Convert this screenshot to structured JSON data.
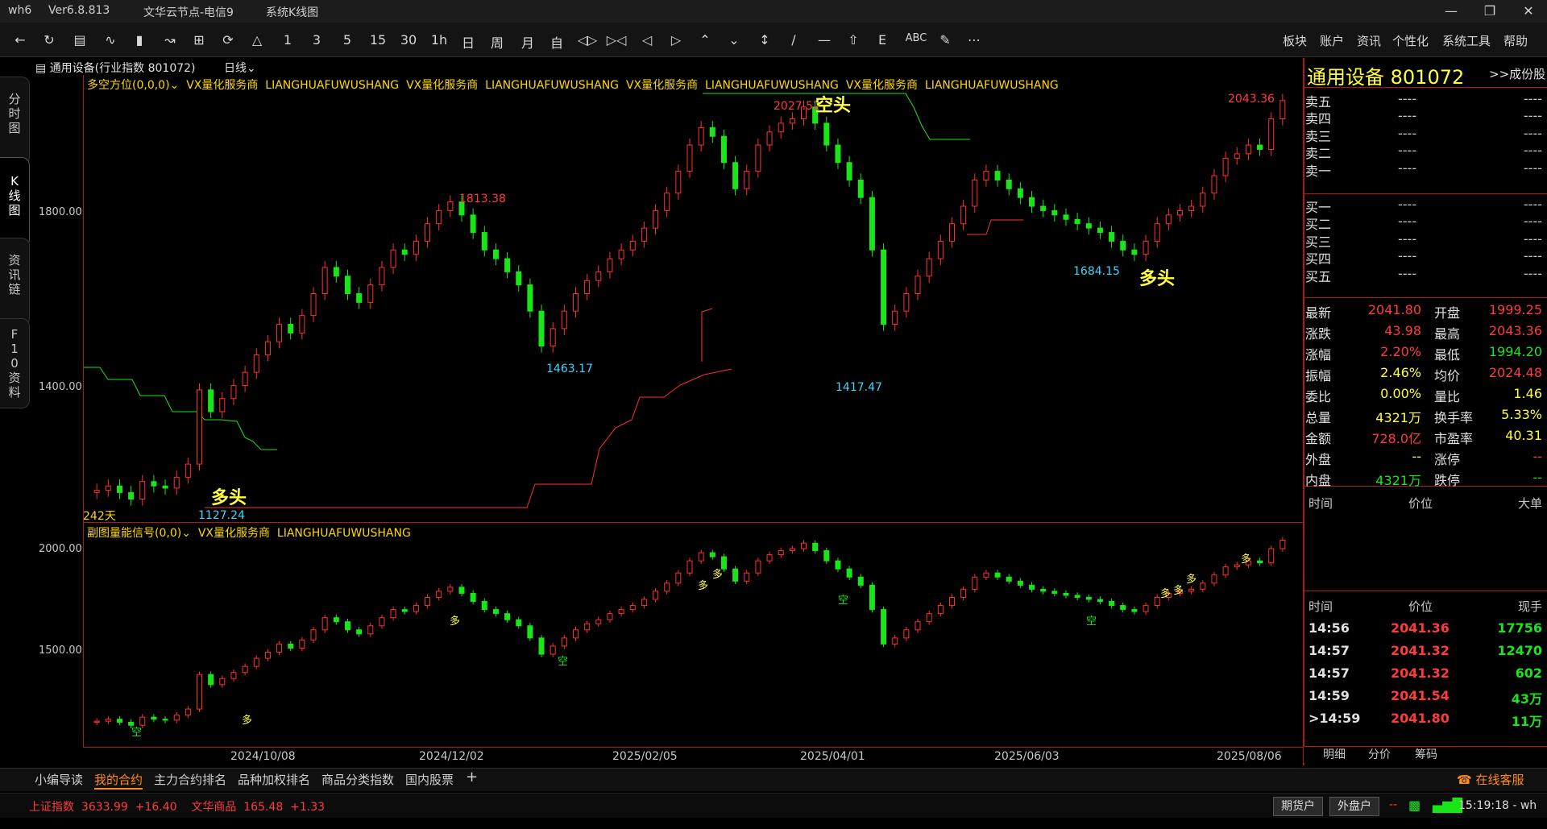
{
  "titlebar": {
    "app": "wh6",
    "version": "Ver6.8.813",
    "server": "文华云节点-电信9",
    "window": "系统K线图"
  },
  "toolbar": {
    "icons": [
      "back-icon",
      "refresh-icon",
      "table-icon",
      "line-chart-icon",
      "bar-chart-icon",
      "drawing-icon",
      "plus-box-icon",
      "refresh2-icon",
      "bell-icon"
    ],
    "periods": [
      "1",
      "3",
      "5",
      "15",
      "30",
      "1h",
      "日",
      "周",
      "月",
      "自"
    ],
    "menus": [
      "板块",
      "账户",
      "资讯",
      "个性化",
      "系统工具",
      "帮助"
    ],
    "abc": "ABC"
  },
  "left_tabs": [
    {
      "label": "分时图"
    },
    {
      "label": "K线图"
    },
    {
      "label": "资讯链"
    },
    {
      "label": "F10资料"
    }
  ],
  "chart_header": {
    "instrument": "通用设备(行业指数 801072)",
    "period": "日线"
  },
  "main_indicator": {
    "name": "多空方位(0,0,0)",
    "labels": [
      "VX量化服务商",
      "LIANGHUAFUWUSHANG",
      "VX量化服务商",
      "LIANGHUAFUWUSHANG",
      "VX量化服务商",
      "LIANGHUAFUWUSHANG",
      "VX量化服务商",
      "LIANGHUAFUWUSHANG"
    ]
  },
  "sub_indicator": {
    "name": "副图量能信号(0,0)",
    "labels": [
      "VX量化服务商",
      "LIANGHUAFUWUSHANG"
    ]
  },
  "main_axis": [
    "1800.00",
    "1400.00"
  ],
  "sub_axis": [
    "2000.00",
    "1500.00"
  ],
  "dates": [
    "2024/10/08",
    "2024/12/02",
    "2025/02/05",
    "2025/04/01",
    "2025/06/03",
    "2025/08/06"
  ],
  "days_label": "242天",
  "annotations": {
    "high1": "1813.38",
    "low1": "1463.17",
    "high2": "2027.52",
    "low2": "1417.47",
    "low3": "1684.15",
    "high3": "2043.36",
    "low0": "1127.24",
    "duotou": "多头",
    "kongtou": "空头"
  },
  "sub_signals": {
    "duo": "多",
    "kong": "空"
  },
  "quote": {
    "name": "通用设备",
    "code": "801072",
    "link": ">>成份股",
    "asks": [
      {
        "label": "卖五",
        "price": "----",
        "vol": "----"
      },
      {
        "label": "卖四",
        "price": "----",
        "vol": "----"
      },
      {
        "label": "卖三",
        "price": "----",
        "vol": "----"
      },
      {
        "label": "卖二",
        "price": "----",
        "vol": "----"
      },
      {
        "label": "卖一",
        "price": "----",
        "vol": "----"
      }
    ],
    "bids": [
      {
        "label": "买一",
        "price": "----",
        "vol": "----"
      },
      {
        "label": "买二",
        "price": "----",
        "vol": "----"
      },
      {
        "label": "买三",
        "price": "----",
        "vol": "----"
      },
      {
        "label": "买四",
        "price": "----",
        "vol": "----"
      },
      {
        "label": "买五",
        "price": "----",
        "vol": "----"
      }
    ],
    "stats": [
      {
        "l": "最新",
        "lv": "2041.80",
        "r": "开盘",
        "rv": "1999.25"
      },
      {
        "l": "涨跌",
        "lv": "43.98",
        "r": "最高",
        "rv": "2043.36"
      },
      {
        "l": "涨幅",
        "lv": "2.20%",
        "r": "最低",
        "rv": "1994.20"
      },
      {
        "l": "振幅",
        "lv": "2.46%",
        "r": "均价",
        "rv": "2024.48"
      },
      {
        "l": "委比",
        "lv": "0.00%",
        "r": "量比",
        "rv": "1.46"
      },
      {
        "l": "总量",
        "lv": "4321万",
        "r": "换手率",
        "rv": "5.33%"
      },
      {
        "l": "金额",
        "lv": "728.0亿",
        "r": "市盈率",
        "rv": "40.31"
      },
      {
        "l": "外盘",
        "lv": "--",
        "r": "涨停",
        "rv": "--"
      },
      {
        "l": "内盘",
        "lv": "4321万",
        "r": "跌停",
        "rv": "--"
      }
    ],
    "block_header": [
      "时间",
      "价位",
      "大单"
    ],
    "ticks_header": [
      "时间",
      "价位",
      "现手"
    ],
    "ticks": [
      {
        "t": "14:56",
        "p": "2041.36",
        "v": "17756"
      },
      {
        "t": "14:57",
        "p": "2041.32",
        "v": "12470"
      },
      {
        "t": "14:57",
        "p": "2041.32",
        "v": "602"
      },
      {
        "t": "14:59",
        "p": "2041.54",
        "v": "43万"
      },
      {
        "t": ">14:59",
        "p": "2041.80",
        "v": "11万"
      }
    ],
    "bottom_tabs": [
      "明细",
      "分价",
      "筹码"
    ]
  },
  "bottom_tabs": [
    "小编导读",
    "我的合约",
    "主力合约排名",
    "品种加权排名",
    "商品分类指数",
    "国内股票"
  ],
  "bottom_active": "我的合约",
  "service": "在线客服",
  "status": {
    "idx1_name": "上证指数",
    "idx1_val": "3633.99",
    "idx1_chg": "+16.40",
    "idx2_name": "文华商品",
    "idx2_val": "165.48",
    "idx2_chg": "+1.33",
    "btn1": "期货户",
    "btn2": "外盘户",
    "dash": "--",
    "time": "15:19:18 - wh"
  },
  "chart_data": {
    "type": "candlestick",
    "series": [
      {
        "close": [
          1150,
          1160,
          1145,
          1130,
          1170,
          1160,
          1155,
          1180,
          1210,
          1380,
          1330,
          1360,
          1390,
          1420,
          1460,
          1490,
          1530,
          1510,
          1550,
          1600,
          1660,
          1640,
          1600,
          1580,
          1620,
          1660,
          1700,
          1690,
          1720,
          1760,
          1790,
          1810,
          1780,
          1740,
          1700,
          1680,
          1650,
          1620,
          1560,
          1480,
          1520,
          1560,
          1600,
          1630,
          1650,
          1680,
          1700,
          1720,
          1750,
          1790,
          1830,
          1880,
          1940,
          1980,
          1960,
          1900,
          1840,
          1880,
          1940,
          1970,
          1990,
          2000,
          2027,
          1990,
          1940,
          1900,
          1860,
          1820,
          1700,
          1530,
          1560,
          1600,
          1640,
          1680,
          1720,
          1760,
          1800,
          1860,
          1880,
          1860,
          1840,
          1820,
          1800,
          1790,
          1780,
          1770,
          1760,
          1750,
          1740,
          1720,
          1700,
          1690,
          1720,
          1760,
          1780,
          1790,
          1800,
          1830,
          1870,
          1910,
          1920,
          1940,
          1930,
          2000,
          2041.8
        ]
      }
    ],
    "annotations": [
      "1813.38",
      "1463.17",
      "2027.52",
      "1417.47",
      "1684.15",
      "2043.36",
      "1127.24"
    ]
  }
}
